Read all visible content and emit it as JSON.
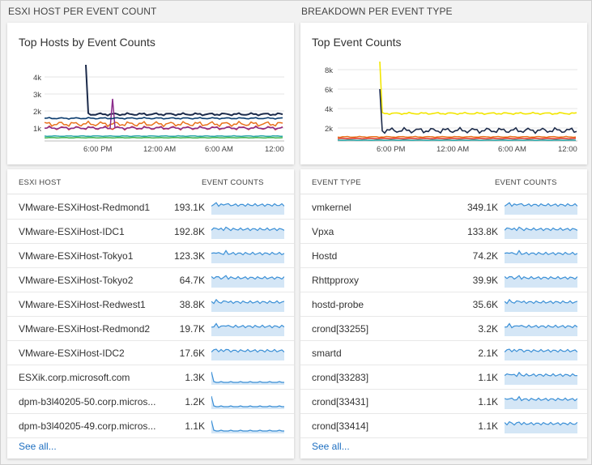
{
  "left": {
    "section_title": "ESXI HOST PER EVENT COUNT",
    "chart_title": "Top Hosts by Event Counts",
    "list_header": {
      "col1": "ESXI HOST",
      "col2": "EVENT COUNTS"
    },
    "rows": [
      {
        "name": "VMware-ESXiHost-Redmond1",
        "count": "193.1K"
      },
      {
        "name": "VMware-ESXiHost-IDC1",
        "count": "192.8K"
      },
      {
        "name": "VMware-ESXiHost-Tokyo1",
        "count": "123.3K"
      },
      {
        "name": "VMware-ESXiHost-Tokyo2",
        "count": "64.7K"
      },
      {
        "name": "VMware-ESXiHost-Redwest1",
        "count": "38.8K"
      },
      {
        "name": "VMware-ESXiHost-Redmond2",
        "count": "19.7K"
      },
      {
        "name": "VMware-ESXiHost-IDC2",
        "count": "17.6K"
      },
      {
        "name": "ESXik.corp.microsoft.com",
        "count": "1.3K"
      },
      {
        "name": "dpm-b3l40205-50.corp.micros...",
        "count": "1.2K"
      },
      {
        "name": "dpm-b3l40205-49.corp.micros...",
        "count": "1.1K"
      }
    ],
    "see_all": "See all..."
  },
  "right": {
    "section_title": "BREAKDOWN PER EVENT TYPE",
    "chart_title": "Top Event Counts",
    "list_header": {
      "col1": "EVENT TYPE",
      "col2": "EVENT COUNTS"
    },
    "rows": [
      {
        "name": "vmkernel",
        "count": "349.1K"
      },
      {
        "name": "Vpxa",
        "count": "133.8K"
      },
      {
        "name": "Hostd",
        "count": "74.2K"
      },
      {
        "name": "Rhttpproxy",
        "count": "39.9K"
      },
      {
        "name": "hostd-probe",
        "count": "35.6K"
      },
      {
        "name": "crond[33255]",
        "count": "3.2K"
      },
      {
        "name": "smartd",
        "count": "2.1K"
      },
      {
        "name": "crond[33283]",
        "count": "1.1K"
      },
      {
        "name": "crond[33431]",
        "count": "1.1K"
      },
      {
        "name": "crond[33414]",
        "count": "1.1K"
      }
    ],
    "see_all": "See all..."
  },
  "charts": {
    "left": {
      "y_ticks": [
        "4k",
        "3k",
        "2k",
        "1k"
      ],
      "x_ticks": [
        "6:00 PM",
        "12:00 AM",
        "6:00 AM",
        "12:00"
      ]
    },
    "right": {
      "y_ticks": [
        "8k",
        "6k",
        "4k",
        "2k"
      ],
      "x_ticks": [
        "6:00 PM",
        "12:00 AM",
        "6:00 AM",
        "12:00"
      ]
    }
  },
  "colors": {
    "spark_line": "#3a8fd6",
    "spark_fill": "#d4e6f6",
    "link": "#1e6fc1"
  }
}
